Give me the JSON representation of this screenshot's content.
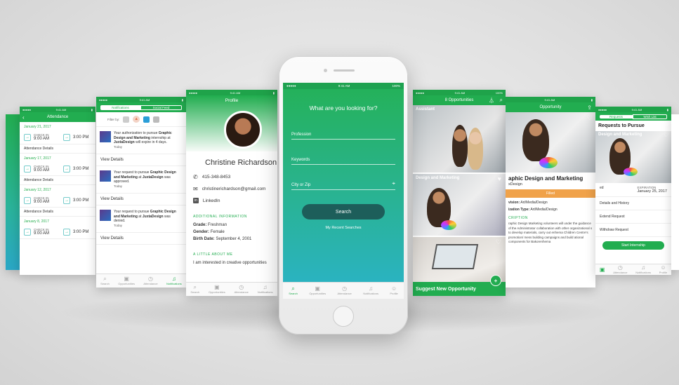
{
  "attendance": {
    "title": "Attendance",
    "entries": [
      {
        "date": "January 21, 2017",
        "in_label": "CHECK IN",
        "in_time": "9:00 AM",
        "out_time": "3:00 PM",
        "details": "Attendance Details"
      },
      {
        "date": "January 17, 2017",
        "in_label": "CHECK IN",
        "in_time": "9:00 AM",
        "out_time": "3:00 PM",
        "details": "Attendance Details"
      },
      {
        "date": "January 12, 2017",
        "in_label": "CHECK IN",
        "in_time": "9:00 AM",
        "out_time": "3:00 PM",
        "details": "Attendance Details"
      },
      {
        "date": "January 8, 2017",
        "in_label": "CHECK IN",
        "in_time": "9:00 AM",
        "out_time": "3:00 PM",
        "details": ""
      }
    ]
  },
  "notifications": {
    "seg_a": "Notifications",
    "seg_b": "Social Feed",
    "filter_label": "Filter by:",
    "items": [
      {
        "text_a": "Your authorization to pursue ",
        "bold_a": "Graphic Design and Marketing",
        "text_b": " internship at ",
        "bold_b": "JuxtaDesign",
        "text_c": " will expire in 4 days.",
        "time": "Today",
        "action": "View Details"
      },
      {
        "text_a": "Your request to pursue ",
        "bold_a": "Graphic Design and Marketing",
        "text_b": " at ",
        "bold_b": "JuxtaDesign",
        "text_c": " was approved.",
        "time": "Today",
        "action": "View Details"
      },
      {
        "text_a": "Your request to pursue ",
        "bold_a": "Graphic Design and Marketing",
        "text_b": " at ",
        "bold_b": "JuxtaDesign",
        "text_c": " was denied.",
        "time": "Today",
        "action": "View Details"
      }
    ],
    "tabs": [
      "Search",
      "Opportunities",
      "Attendance",
      "Notifications"
    ]
  },
  "profile": {
    "time": "9:41 AM",
    "title": "Profile",
    "name": "Christine Richardson",
    "phone": "415-348-8453",
    "email": "christinerichardson@gmail.com",
    "linkedin": "LinkedIn",
    "additional_header": "ADDITIONAL INFORMATION",
    "grade_label": "Grade:",
    "grade": "Freshman",
    "gender_label": "Gender:",
    "gender": "Female",
    "birth_label": "Birth Date:",
    "birth": "September 4, 2001",
    "about_header": "A LITTLE ABOUT ME",
    "about": "I am interested in creative opportunities",
    "tabs": [
      "Search",
      "Opportunities",
      "Attendance",
      "Notifications"
    ]
  },
  "search": {
    "carrier": "●●●●● ",
    "time": "9:41 AM",
    "battery": "100%",
    "question": "What are you looking for?",
    "profession_placeholder": "Profession",
    "keywords_placeholder": "Keywords",
    "city_placeholder": "City or Zip",
    "search_button": "Search",
    "recent_link": "My Recent Searches",
    "tabs": [
      "Search",
      "Opportunities",
      "Attendance",
      "Notifications",
      "Profile"
    ]
  },
  "opportunities": {
    "time": "9:41 AM",
    "battery": "100%",
    "title": "8 Opportunities",
    "label_1": "Assistant",
    "label_2": "Design and Marketing",
    "suggest": "Suggest New Opportunity"
  },
  "opportunity": {
    "time": "9:41 AM",
    "title": "Opportunity",
    "heading": "aphic Design and Marketing",
    "company": "xDesign",
    "status": "Filled",
    "division_label": "vision:",
    "division": "Art/Media/Design",
    "type_label": "ization Type:",
    "type": "Art/Media/Design",
    "section": "CRIPTION",
    "description": "raphic Design Marketing volunteers will under the guidance of the Administrator collaboration with other organizational s to develop materials, carry out enhema Children Centre's promotion/ mess building campaigns and build ational components for Bakorenhema"
  },
  "requests": {
    "seg_a": "Requests",
    "seg_b": "Wish List",
    "title": "Requests to Pursue",
    "photo_label": "Design and Marketing",
    "status_label": "ed",
    "expiration_label": "EXPIRATION",
    "expiration": "January 25, 2017",
    "rows": [
      "Details and History",
      "Extend Request",
      "Withdraw Request"
    ],
    "start_button": "Start Internship",
    "tabs": [
      "Attendance",
      "Notifications",
      "Profile"
    ]
  }
}
